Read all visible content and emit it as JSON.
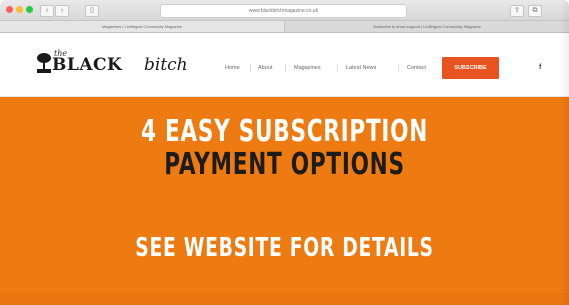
{
  "browser": {
    "address": "www.blackbitchmagazine.co.uk",
    "tabs": [
      "Magazines | Linlithgow Community Magazine",
      "Subscribe to show support | Linlithgow Community Magazine"
    ],
    "traffic_colors": [
      "#ff5f57",
      "#febc2e",
      "#28c840"
    ]
  },
  "header": {
    "logo_small": "the",
    "logo_main": "BLACK",
    "logo_script": "bitch",
    "nav": [
      "Home",
      "About",
      "Magazines",
      "Latest News",
      "Contact"
    ],
    "subscribe_label": "SUBSCRIBE",
    "social_icon": "f"
  },
  "banner": {
    "line1": "4 EASY SUBSCRIPTION",
    "line2": "PAYMENT OPTIONS",
    "line3": "SEE WEBSITE FOR DETAILS",
    "accent": "#ee7a12"
  }
}
